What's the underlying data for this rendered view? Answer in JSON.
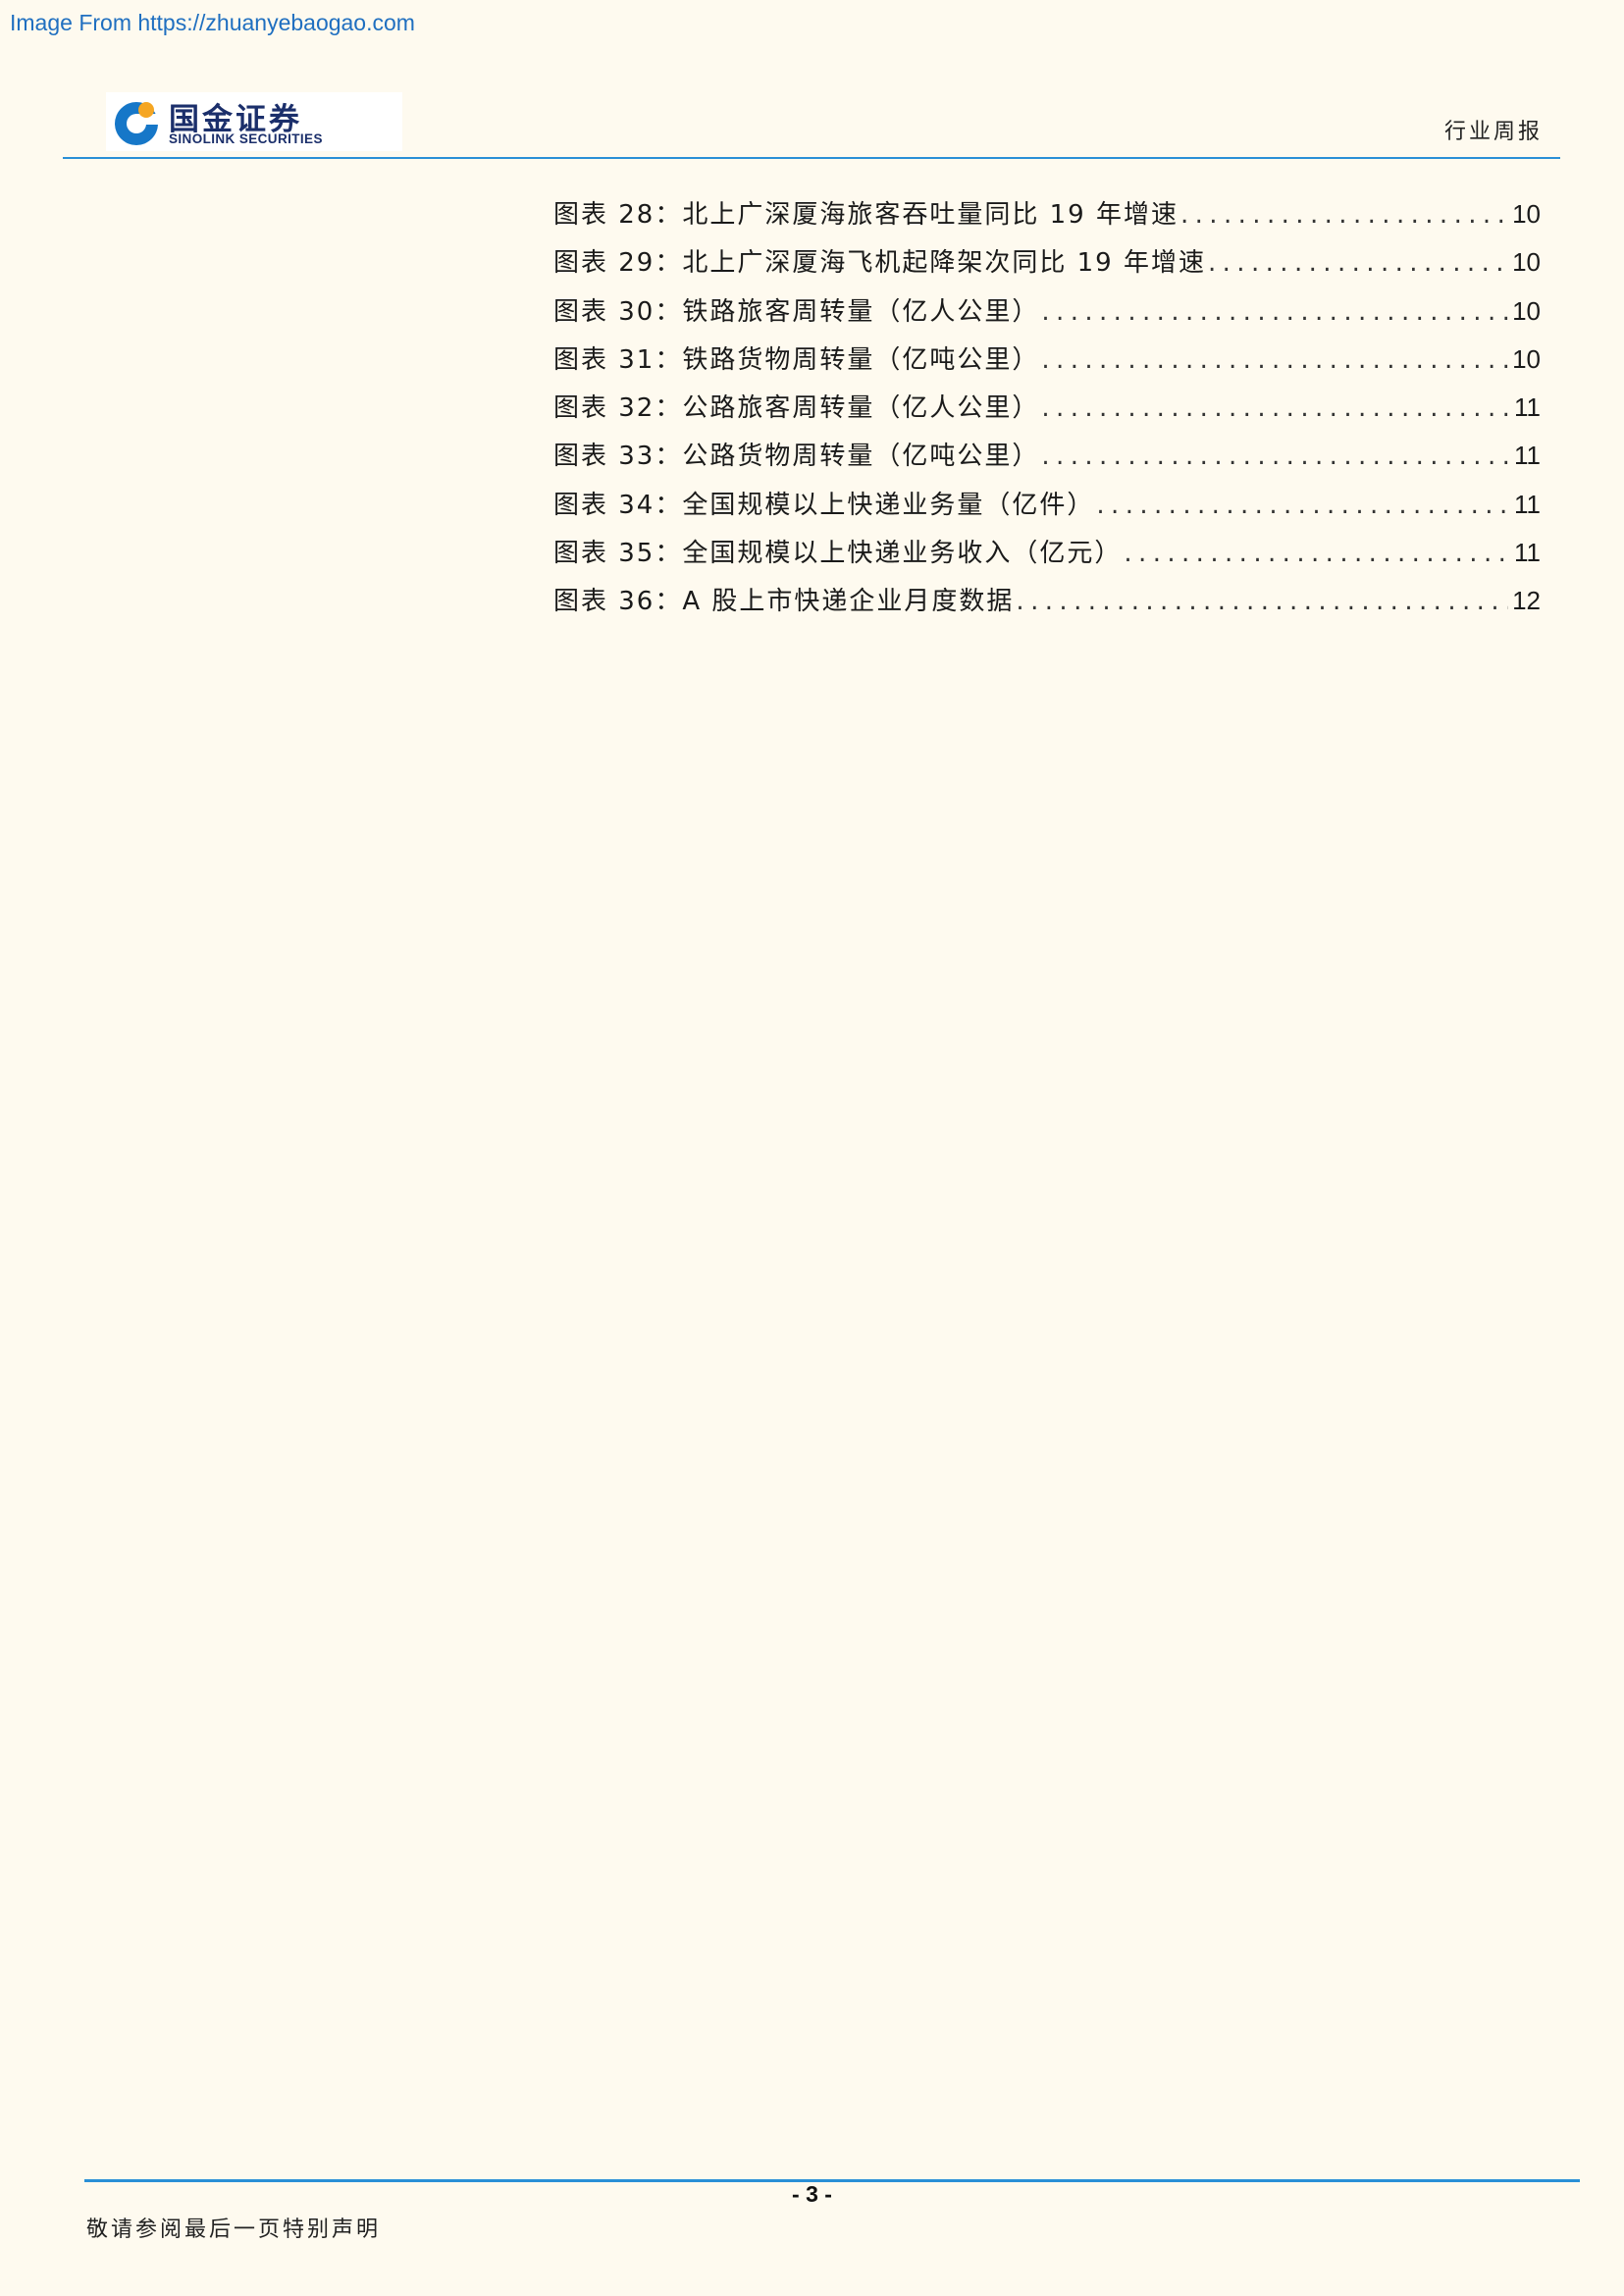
{
  "watermark": "Image From https://zhuanyebaogao.com",
  "header": {
    "logo_cn": "国金证券",
    "logo_en": "SINOLINK SECURITIES",
    "report_type": "行业周报",
    "colors": {
      "rule": "#2a8fd6",
      "logo_text": "#1b2f6b",
      "logo_accent": "#f5a623"
    }
  },
  "toc": [
    {
      "label": "图表 28：北上广深厦海旅客吞吐量同比 19 年增速",
      "page": "10"
    },
    {
      "label": "图表 29：北上广深厦海飞机起降架次同比 19 年增速",
      "page": "10"
    },
    {
      "label": "图表 30：铁路旅客周转量（亿人公里）",
      "page": "10"
    },
    {
      "label": "图表 31：铁路货物周转量（亿吨公里）",
      "page": "10"
    },
    {
      "label": "图表 32：公路旅客周转量（亿人公里）",
      "page": "11"
    },
    {
      "label": "图表 33：公路货物周转量（亿吨公里）",
      "page": "11"
    },
    {
      "label": "图表 34：全国规模以上快递业务量（亿件）",
      "page": "11"
    },
    {
      "label": "图表 35：全国规模以上快递业务收入（亿元）",
      "page": "11"
    },
    {
      "label": "图表 36：A 股上市快递企业月度数据",
      "page": "12"
    }
  ],
  "footer": {
    "page_number": "- 3 -",
    "disclaimer": "敬请参阅最后一页特别声明"
  }
}
